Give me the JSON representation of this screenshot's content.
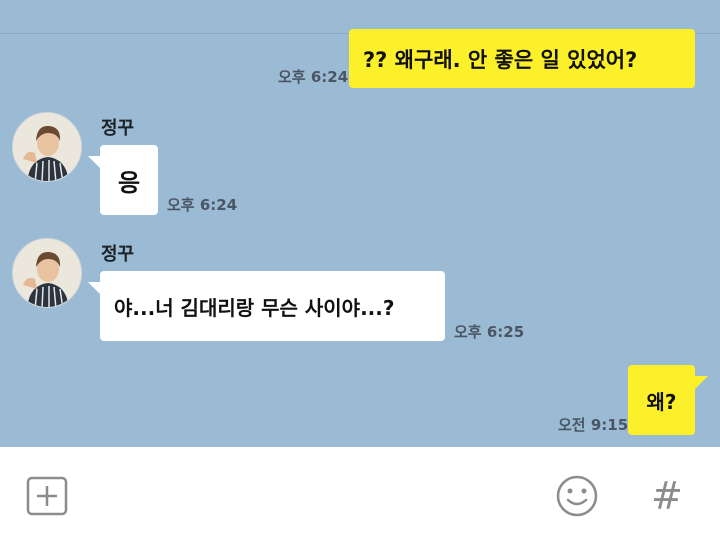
{
  "messages": [
    {
      "sender": "me",
      "text": "?? 왜구래. 안 좋은 일 있었어?",
      "time": "오후 6:24"
    },
    {
      "sender": "other",
      "name": "정꾸",
      "text": "응",
      "time": "오후 6:24"
    },
    {
      "sender": "other",
      "name": "정꾸",
      "text": "야...너 김대리랑 무슨 사이야...?",
      "time": "오후 6:25"
    },
    {
      "sender": "me",
      "text": "왜?",
      "time": "오전 9:15"
    }
  ],
  "input_bar": {
    "add_icon": "plus-square-icon",
    "emoji_icon": "smiley-icon",
    "hashtag_icon": "hashtag-icon",
    "hashtag_symbol": "#"
  },
  "colors": {
    "chat_background": "#9bbbd4",
    "my_bubble": "#fcf02b",
    "other_bubble": "#ffffff",
    "icon_gray": "#8c8c8c"
  }
}
